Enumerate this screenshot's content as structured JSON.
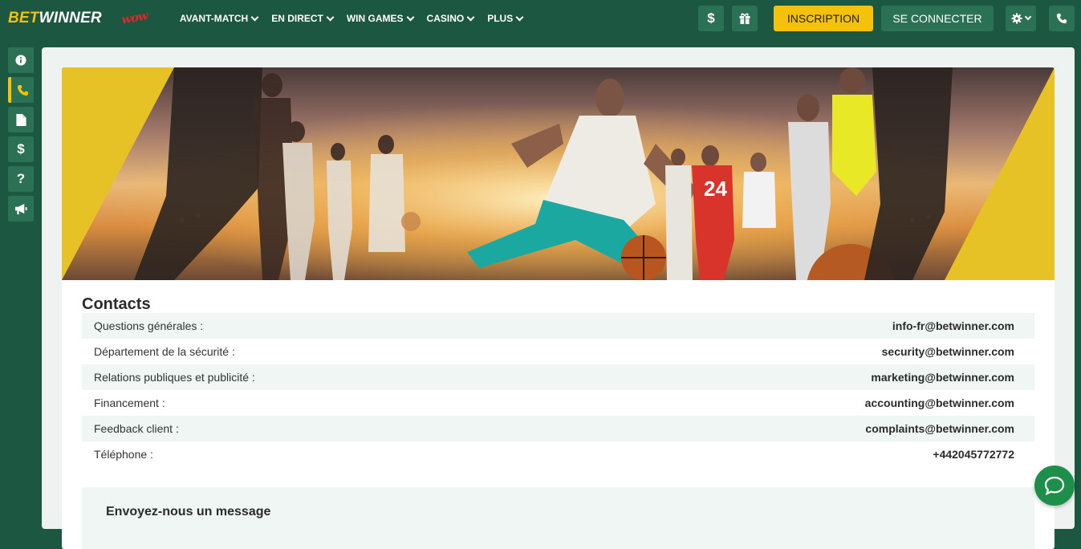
{
  "header": {
    "logo_bet": "BET",
    "logo_winner": "WINNER",
    "promo_text": "wow",
    "nav": [
      {
        "label": "AVANT-MATCH"
      },
      {
        "label": "EN DIRECT"
      },
      {
        "label": "WIN GAMES"
      },
      {
        "label": "CASINO"
      },
      {
        "label": "PLUS"
      }
    ],
    "dollar_symbol": "$",
    "inscription_label": "INSCRIPTION",
    "connect_label": "SE CONNECTER"
  },
  "sidebar": {
    "items": [
      {
        "icon": "info-icon"
      },
      {
        "icon": "phone-icon",
        "active": true
      },
      {
        "icon": "document-icon"
      },
      {
        "icon": "dollar-icon",
        "symbol": "$"
      },
      {
        "icon": "question-icon",
        "symbol": "?"
      },
      {
        "icon": "megaphone-icon"
      }
    ]
  },
  "contacts": {
    "title": "Contacts",
    "rows": [
      {
        "label": "Questions générales :",
        "value": "info-fr@betwinner.com"
      },
      {
        "label": "Département de la sécurité :",
        "value": "security@betwinner.com"
      },
      {
        "label": "Relations publiques et publicité :",
        "value": "marketing@betwinner.com"
      },
      {
        "label": "Financement :",
        "value": "accounting@betwinner.com"
      },
      {
        "label": "Feedback client :",
        "value": "complaints@betwinner.com"
      },
      {
        "label": "Téléphone :",
        "value": "+442045772772"
      }
    ]
  },
  "message": {
    "title": "Envoyez-nous un message"
  },
  "colors": {
    "brand_green": "#1c5741",
    "button_green": "#2a7155",
    "accent_yellow": "#f4c20d",
    "chat_green": "#1e8f4a"
  }
}
